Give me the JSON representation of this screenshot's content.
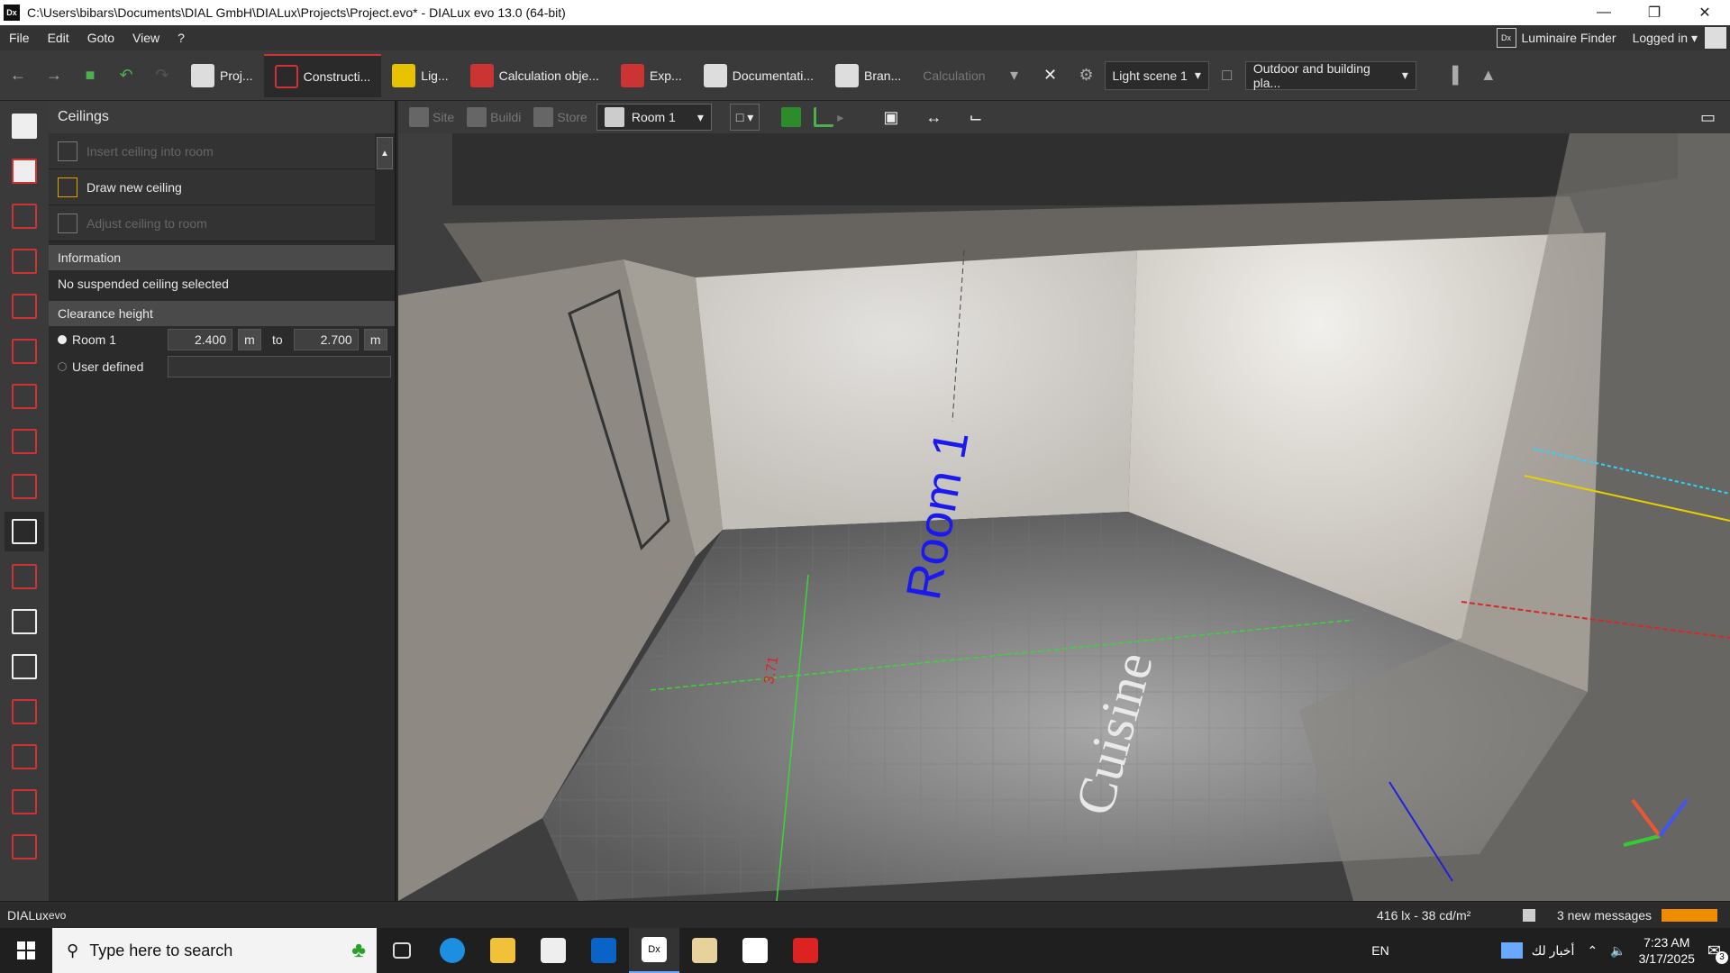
{
  "window": {
    "title": "C:\\Users\\bibars\\Documents\\DIAL GmbH\\DIALux\\Projects\\Project.evo* - DIALux evo 13.0  (64-bit)",
    "logo": "Dx"
  },
  "menu": {
    "items": [
      "File",
      "Edit",
      "Goto",
      "View",
      "?"
    ],
    "luminaire_finder": "Luminaire Finder",
    "logged_in": "Logged in"
  },
  "toolbar": {
    "tabs": [
      {
        "label": "Proj..."
      },
      {
        "label": "Constructi..."
      },
      {
        "label": "Lig..."
      },
      {
        "label": "Calculation obje..."
      },
      {
        "label": "Exp..."
      },
      {
        "label": "Documentati..."
      },
      {
        "label": "Bran..."
      }
    ],
    "calculation": "Calculation",
    "light_scene": "Light scene 1",
    "plan": "Outdoor and building pla..."
  },
  "panel": {
    "title": "Ceilings",
    "actions": [
      {
        "label": "Insert ceiling into room",
        "enabled": false
      },
      {
        "label": "Draw new ceiling",
        "enabled": true
      },
      {
        "label": "Adjust ceiling to room",
        "enabled": false
      }
    ],
    "information": {
      "header": "Information",
      "text": "No suspended ceiling selected"
    },
    "clearance": {
      "header": "Clearance height",
      "room_label": "Room 1",
      "from": "2.400",
      "to_label": "to",
      "to": "2.700",
      "unit": "m",
      "user_defined": "User defined"
    }
  },
  "subbar": {
    "site": "Site",
    "building": "Buildi",
    "storey": "Store",
    "room": "Room 1"
  },
  "viewport": {
    "room_label": "Room 1",
    "floor_text": "Cuisine",
    "dimension": "3.71"
  },
  "status": {
    "app_name": "DIALux",
    "app_suffix": "evo",
    "lux": "416 lx - 38 cd/m²",
    "messages": "3 new messages"
  },
  "taskbar": {
    "search_placeholder": "Type here to search",
    "lang": "EN",
    "news": "أخبار لك",
    "time": "7:23 AM",
    "date": "3/17/2025",
    "notifications": "3"
  },
  "colors": {
    "accent_red": "#cc3333",
    "room_label": "#1a1aee",
    "message_bar": "#f08c00"
  }
}
